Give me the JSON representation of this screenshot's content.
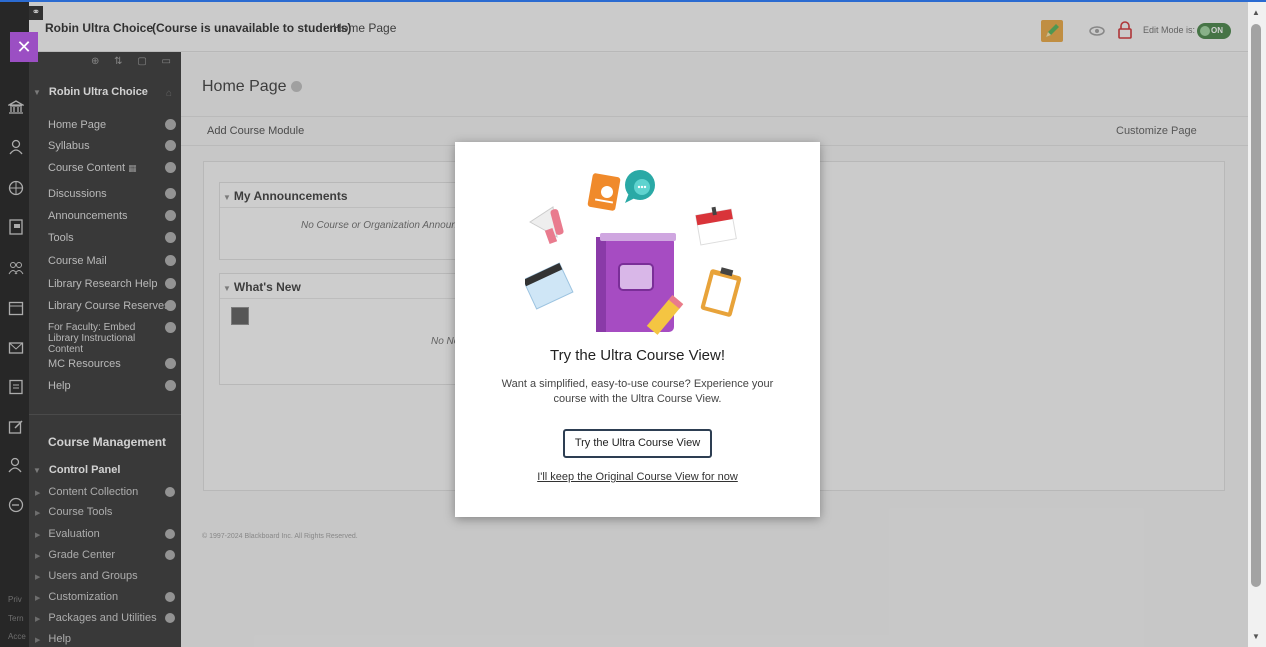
{
  "header": {
    "course_name": "Robin Ultra Choice",
    "availability": "(Course is unavailable to students)",
    "breadcrumb": "Home Page",
    "edit_mode_label": "Edit Mode is:",
    "edit_mode_state": "ON"
  },
  "menu": {
    "course_title": "Robin Ultra Choice",
    "items": [
      {
        "label": "Home Page"
      },
      {
        "label": "Syllabus"
      },
      {
        "label": "Course Content"
      },
      {
        "label": "Discussions"
      },
      {
        "label": "Announcements"
      },
      {
        "label": "Tools"
      },
      {
        "label": "Course Mail"
      },
      {
        "label": "Library Research Help"
      },
      {
        "label": "Library Course Reserves"
      },
      {
        "label": "For Faculty: Embed Library Instructional Content"
      },
      {
        "label": "MC Resources"
      },
      {
        "label": "Help"
      }
    ],
    "management_title": "Course Management",
    "control_panel": "Control Panel",
    "cp_items": [
      {
        "label": "Content Collection"
      },
      {
        "label": "Course Tools"
      },
      {
        "label": "Evaluation"
      },
      {
        "label": "Grade Center"
      },
      {
        "label": "Users and Groups"
      },
      {
        "label": "Customization"
      },
      {
        "label": "Packages and Utilities"
      },
      {
        "label": "Help"
      }
    ]
  },
  "rail": {
    "footer": [
      "Priv",
      "Tern",
      "Acce"
    ]
  },
  "main": {
    "page_title": "Home Page",
    "add_module": "Add Course Module",
    "customize": "Customize Page",
    "announcements_title": "My Announcements",
    "announcements_empty": "No Course or Organization Announcer",
    "whats_new_title": "What's New",
    "whats_new_empty": "No No",
    "copyright": "© 1997-2024 Blackboard Inc. All Rights Reserved."
  },
  "modal": {
    "title": "Try the Ultra Course View!",
    "body": "Want a simplified, easy-to-use course? Experience your course with the Ultra Course View.",
    "primary_button": "Try the Ultra Course View",
    "secondary_link": "I'll keep the Original Course View for now"
  },
  "colors": {
    "accent_purple": "#9b4fc3",
    "toggle_green": "#3f7f3f",
    "edit_orange": "#e8a33a"
  }
}
